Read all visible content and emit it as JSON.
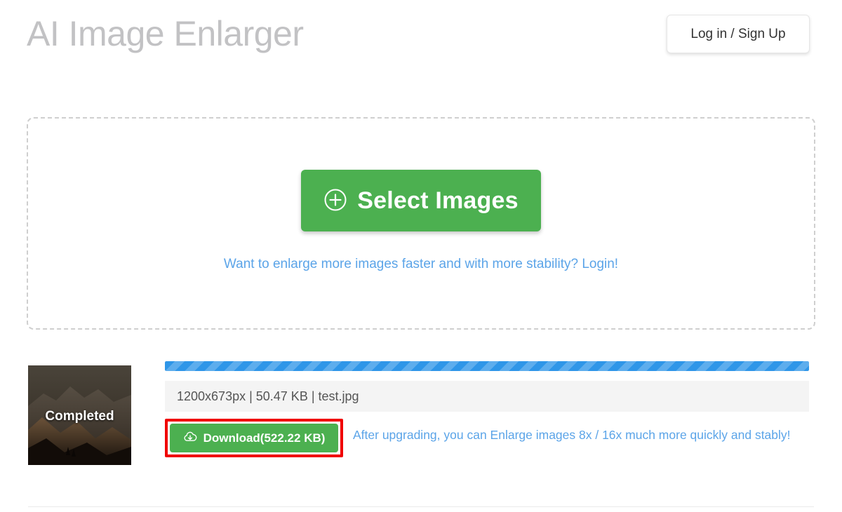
{
  "header": {
    "title": "AI Image Enlarger",
    "login_button": "Log in / Sign Up"
  },
  "dropzone": {
    "select_button_label": "Select Images",
    "select_button_icon": "plus-circle-icon",
    "upsell_link": "Want to enlarge more images faster and with more stability? Login!"
  },
  "result": {
    "status_label": "Completed",
    "progress_percent": 100,
    "file_info": "1200x673px | 50.47 KB | test.jpg",
    "download_button_label": "Download(522.22 KB)",
    "download_button_icon": "cloud-download-icon",
    "upgrade_note": "After upgrading, you can Enlarge images 8x / 16x much more quickly and stably!"
  },
  "colors": {
    "green_button": "#4cb050",
    "blue_link": "#5ba4e8",
    "progress_blue": "#2f96e8",
    "highlight_red": "#f00000",
    "title_gray": "#c2c2c4"
  }
}
